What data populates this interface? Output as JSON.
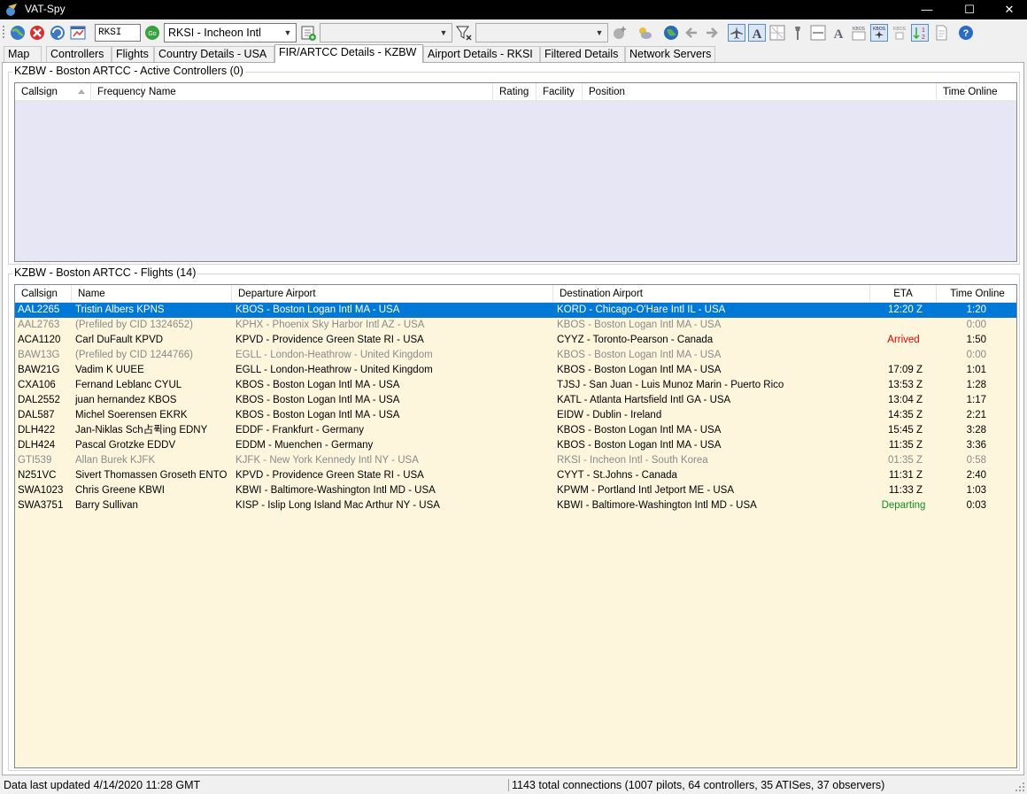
{
  "window": {
    "title": "VAT-Spy",
    "minimize_glyph": "—",
    "maximize_glyph": "☐",
    "close_glyph": "✕"
  },
  "toolbar": {
    "icao_input_value": "RKSI",
    "airport_combo_value": "RKSI - Incheon Intl",
    "combo2_value": "",
    "filter_combo_value": ""
  },
  "tabs": [
    {
      "label": "Map"
    },
    {
      "label": "Controllers"
    },
    {
      "label": "Flights"
    },
    {
      "label": "Country Details - USA"
    },
    {
      "label": "FIR/ARTCC Details - KZBW"
    },
    {
      "label": "Airport Details - RKSI"
    },
    {
      "label": "Filtered Details"
    },
    {
      "label": "Network Servers"
    }
  ],
  "controllers_group": {
    "title": "KZBW - Boston ARTCC - Active Controllers (0)",
    "columns": [
      "Callsign",
      "Frequency",
      "Name",
      "Rating",
      "Facility",
      "Position",
      "Time Online"
    ]
  },
  "flights_group": {
    "title": "KZBW - Boston ARTCC - Flights (14)",
    "columns": [
      "Callsign",
      "Name",
      "Departure Airport",
      "Destination Airport",
      "ETA",
      "Time Online"
    ],
    "rows": [
      {
        "callsign": "AAL2265",
        "name": "Tristin Albers KPNS",
        "dep": "KBOS - Boston Logan Intl MA - USA",
        "dest": "KORD - Chicago-O'Hare Intl IL - USA",
        "eta": "12:20 Z",
        "online": "1:20",
        "state": "selected"
      },
      {
        "callsign": "AAL2763",
        "name": "(Prefiled by CID 1324652)",
        "dep": "KPHX - Phoenix Sky Harbor Intl AZ - USA",
        "dest": "KBOS - Boston Logan Intl MA - USA",
        "eta": "",
        "online": "0:00",
        "state": "prefiled"
      },
      {
        "callsign": "ACA1120",
        "name": "Carl DuFault KPVD",
        "dep": "KPVD - Providence Green State RI - USA",
        "dest": "CYYZ - Toronto-Pearson - Canada",
        "eta": "Arrived",
        "online": "1:50",
        "state": "arrived"
      },
      {
        "callsign": "BAW13G",
        "name": "(Prefiled by CID 1244766)",
        "dep": "EGLL - London-Heathrow - United Kingdom",
        "dest": "KBOS - Boston Logan Intl MA - USA",
        "eta": "",
        "online": "0:00",
        "state": "prefiled"
      },
      {
        "callsign": "BAW21G",
        "name": "Vadim K UUEE",
        "dep": "EGLL - London-Heathrow - United Kingdom",
        "dest": "KBOS - Boston Logan Intl MA - USA",
        "eta": "17:09 Z",
        "online": "1:01",
        "state": "normal"
      },
      {
        "callsign": "CXA106",
        "name": "Fernand Leblanc CYUL",
        "dep": "KBOS - Boston Logan Intl MA - USA",
        "dest": "TJSJ - San Juan - Luis Munoz Marin - Puerto Rico",
        "eta": "13:53 Z",
        "online": "1:28",
        "state": "normal"
      },
      {
        "callsign": "DAL2552",
        "name": "juan hernandez KBOS",
        "dep": "KBOS - Boston Logan Intl MA - USA",
        "dest": "KATL - Atlanta Hartsfield Intl GA - USA",
        "eta": "13:04 Z",
        "online": "1:17",
        "state": "normal"
      },
      {
        "callsign": "DAL587",
        "name": "Michel Soerensen EKRK",
        "dep": "KBOS - Boston Logan Intl MA - USA",
        "dest": "EIDW - Dublin - Ireland",
        "eta": "14:35 Z",
        "online": "2:21",
        "state": "normal"
      },
      {
        "callsign": "DLH422",
        "name": "Jan-Niklas Sch占퓍ing EDNY",
        "dep": "EDDF - Frankfurt - Germany",
        "dest": "KBOS - Boston Logan Intl MA - USA",
        "eta": "15:45 Z",
        "online": "3:28",
        "state": "normal"
      },
      {
        "callsign": "DLH424",
        "name": "Pascal Grotzke EDDV",
        "dep": "EDDM - Muenchen - Germany",
        "dest": "KBOS - Boston Logan Intl MA - USA",
        "eta": "11:35 Z",
        "online": "3:36",
        "state": "normal"
      },
      {
        "callsign": "GTI539",
        "name": "Allan Burek KJFK",
        "dep": "KJFK - New York Kennedy Intl NY - USA",
        "dest": "RKSI - Incheon Intl - South Korea",
        "eta": "01:35 Z",
        "online": "0:58",
        "state": "prefiled"
      },
      {
        "callsign": "N251VC",
        "name": "Sivert Thomassen Groseth ENTO",
        "dep": "KPVD - Providence Green State RI - USA",
        "dest": "CYYT - St.Johns - Canada",
        "eta": "11:31 Z",
        "online": "2:40",
        "state": "normal"
      },
      {
        "callsign": "SWA1023",
        "name": "Chris Greene KBWI",
        "dep": "KBWI - Baltimore-Washington Intl MD - USA",
        "dest": "KPWM - Portland Intl Jetport ME - USA",
        "eta": "11:33 Z",
        "online": "1:03",
        "state": "normal"
      },
      {
        "callsign": "SWA3751",
        "name": "Barry Sullivan",
        "dep": "KISP - Islip Long Island Mac Arthur NY - USA",
        "dest": "KBWI - Baltimore-Washington Intl MD - USA",
        "eta": "Departing",
        "online": "0:03",
        "state": "departing"
      }
    ]
  },
  "status": {
    "left": "Data last updated 4/14/2020 11:28 GMT",
    "right": "1143 total connections (1007 pilots, 64 controllers, 35 ATISes, 37 observers)"
  },
  "colors": {
    "list_background": "#e6e6f4",
    "flights_background": "#fdf6dd",
    "selection": "#0078d7",
    "arrived": "#e00000",
    "departing": "#109020"
  }
}
